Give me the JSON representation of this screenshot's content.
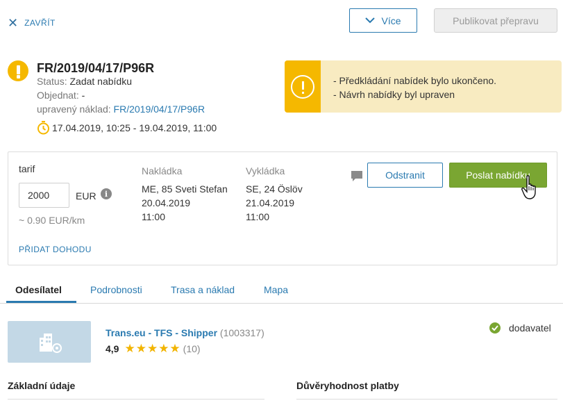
{
  "topbar": {
    "close_label": "ZAVŘÍT",
    "more_label": "Více",
    "publish_label": "Publikovat přepravu"
  },
  "header": {
    "reference": "FR/2019/04/17/P96R",
    "status_label": "Status:",
    "status_value": "Zadat nabídku",
    "ordered_label": "Objednat:",
    "ordered_value": "-",
    "modified_label": "upravený náklad:",
    "modified_link": "FR/2019/04/17/P96R",
    "date_range": "17.04.2019, 10:25 - 19.04.2019, 11:00"
  },
  "alert": {
    "messages": [
      "- Předkládání nabídek bylo ukončeno.",
      "- Návrh nabídky byl upraven"
    ],
    "color": "#f5b800"
  },
  "offer": {
    "tarif_label": "tarif",
    "tarif_value": "2000",
    "currency": "EUR",
    "per_km": "~ 0.90  EUR/km",
    "add_deal": "PŘIDAT DOHODU",
    "loading": {
      "label": "Nakládka",
      "place": "ME, 85 Sveti Stefan",
      "date": "20.04.2019",
      "time": "11:00"
    },
    "unloading": {
      "label": "Vykládka",
      "place": "SE, 24 Öslöv",
      "date": "21.04.2019",
      "time": "11:00"
    },
    "remove_label": "Odstranit",
    "send_label": "Poslat nabídku",
    "send_color": "#7aa632"
  },
  "tabs": [
    {
      "label": "Odesílatel",
      "active": true
    },
    {
      "label": "Podrobnosti",
      "active": false
    },
    {
      "label": "Trasa a náklad",
      "active": false
    },
    {
      "label": "Mapa",
      "active": false
    }
  ],
  "company": {
    "name": "Trans.eu - TFS - Shipper",
    "id": "(1003317)",
    "rating": "4,9",
    "stars": "★★★★★",
    "rating_count": "(10)",
    "supplier_label": "dodavatel"
  },
  "sections": {
    "basic": "Základní údaje",
    "trust": "Důvěryhodnost platby"
  },
  "colors": {
    "accent": "#2a7ab0",
    "warning": "#f5b800",
    "success": "#7aa632"
  }
}
